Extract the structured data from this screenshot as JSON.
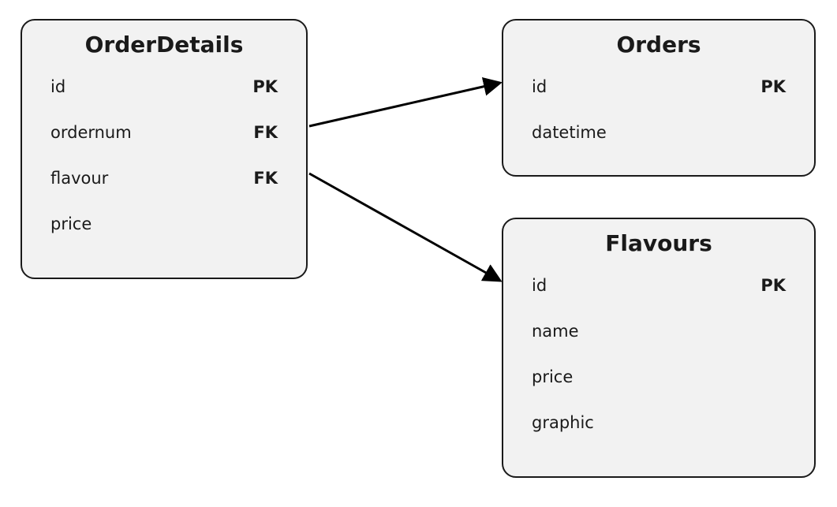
{
  "entities": {
    "orderDetails": {
      "title": "OrderDetails",
      "fields": [
        {
          "name": "id",
          "key": "PK"
        },
        {
          "name": "ordernum",
          "key": "FK"
        },
        {
          "name": "flavour",
          "key": "FK"
        },
        {
          "name": "price",
          "key": ""
        }
      ]
    },
    "orders": {
      "title": "Orders",
      "fields": [
        {
          "name": "id",
          "key": "PK"
        },
        {
          "name": "datetime",
          "key": ""
        }
      ]
    },
    "flavours": {
      "title": "Flavours",
      "fields": [
        {
          "name": "id",
          "key": "PK"
        },
        {
          "name": "name",
          "key": ""
        },
        {
          "name": "price",
          "key": ""
        },
        {
          "name": "graphic",
          "key": ""
        }
      ]
    }
  },
  "relations": [
    {
      "from": "OrderDetails.ordernum",
      "to": "Orders.id"
    },
    {
      "from": "OrderDetails.flavour",
      "to": "Flavours.id"
    }
  ]
}
